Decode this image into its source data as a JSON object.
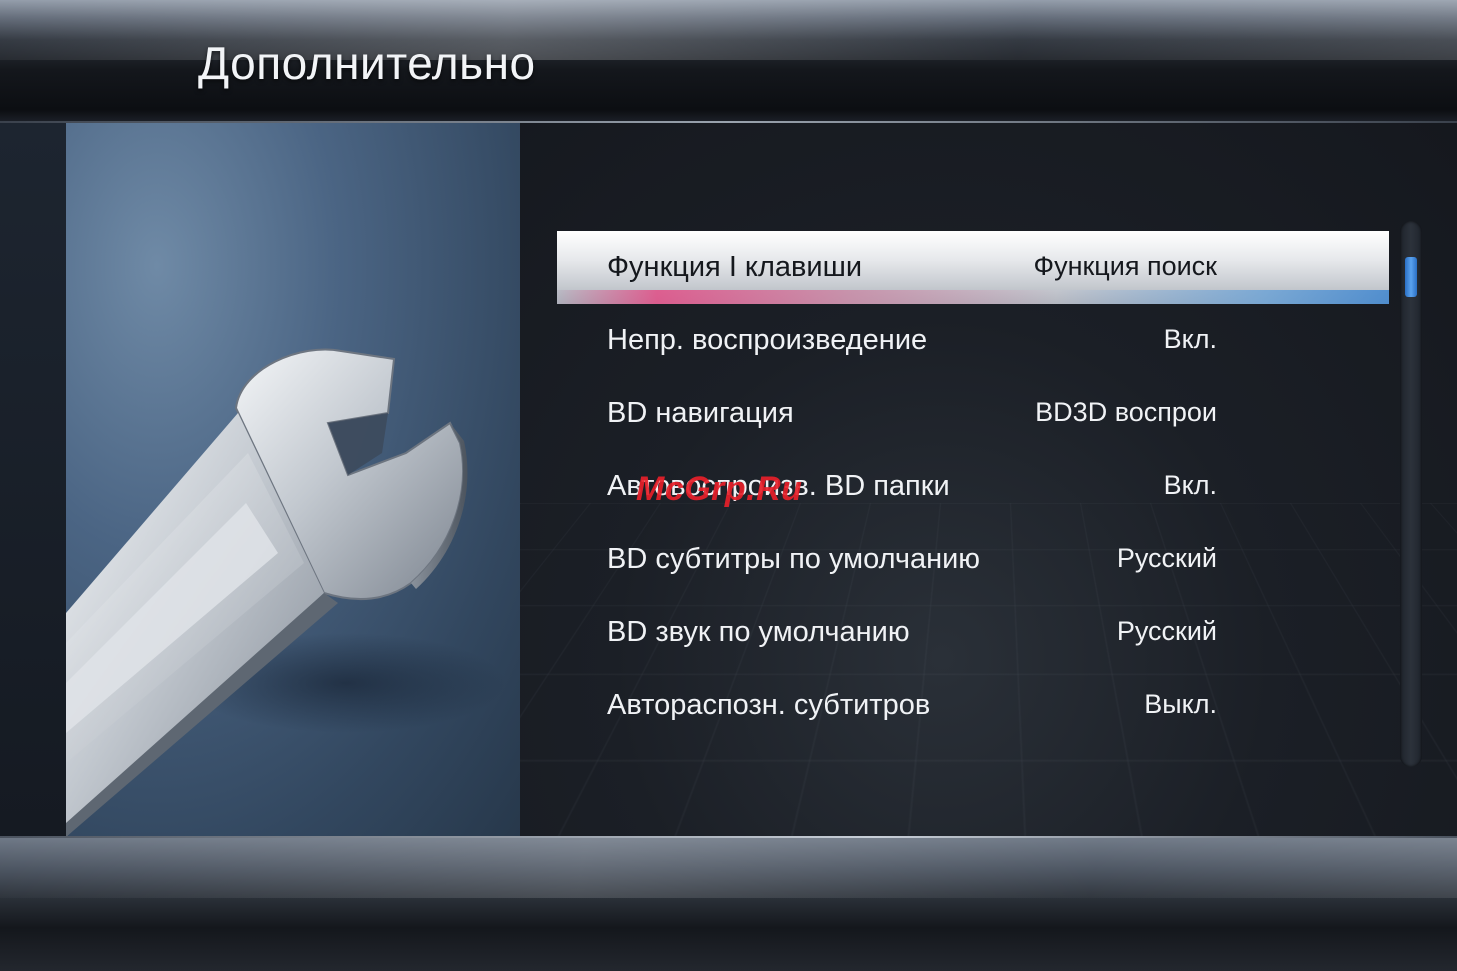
{
  "page": {
    "title": "Дополнительно"
  },
  "menu": {
    "items": [
      {
        "label": "Функция I клавиши",
        "value": "Функция поиск",
        "selected": true
      },
      {
        "label": "Непр. воспроизведение",
        "value": "Вкл.",
        "selected": false
      },
      {
        "label": "BD навигация",
        "value": "BD3D воспрои",
        "selected": false
      },
      {
        "label": "Автовоспроизв. BD папки",
        "value": "Вкл.",
        "selected": false
      },
      {
        "label": "BD субтитры по умолчанию",
        "value": "Русский",
        "selected": false
      },
      {
        "label": "BD звук по умолчанию",
        "value": "Русский",
        "selected": false
      },
      {
        "label": "Автораспозн. субтитров",
        "value": "Выкл.",
        "selected": false
      }
    ]
  },
  "watermark": {
    "text": "McGrp.Ru"
  },
  "icons": {
    "illustration": "wrench-icon"
  },
  "colors": {
    "highlight_pink": "#e24d86",
    "highlight_blue": "#3f86d0",
    "scroll_thumb": "#3a86dc",
    "watermark": "#e8202a"
  }
}
